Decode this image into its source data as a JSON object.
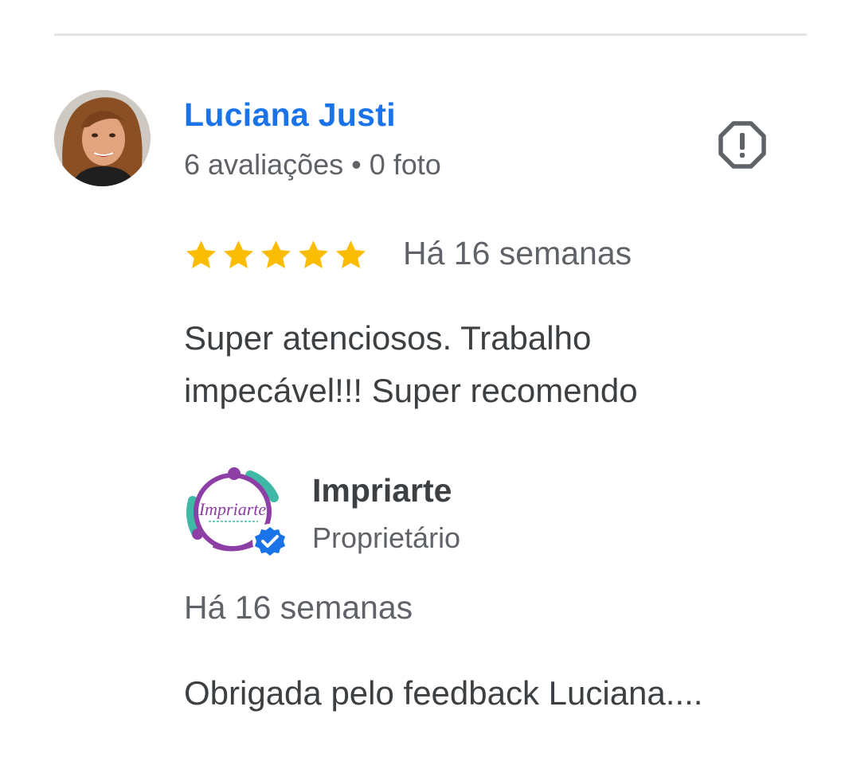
{
  "review": {
    "reviewer": {
      "name": "Luciana Justi",
      "meta": "6 avaliações • 0 foto",
      "avatar_icon": "reviewer-photo"
    },
    "report_icon": "report-flag-icon",
    "rating": 5,
    "rating_max": 5,
    "time": "Há 16 semanas",
    "text": "Super atenciosos. Trabalho impecável!!! Super recomendo"
  },
  "owner_reply": {
    "name": "Impriarte",
    "role": "Proprietário",
    "logo_text": "Impriarte",
    "verified_icon": "verified-badge-icon",
    "time": "Há 16 semanas",
    "text": "Obrigada pelo feedback Luciana...."
  },
  "colors": {
    "link": "#1a73e8",
    "star": "#fbbc04",
    "text_primary": "#3c4043",
    "text_secondary": "#5f6368",
    "divider": "#e3e3e3",
    "brand_purple": "#8e3fa6",
    "brand_teal": "#3fb8a6",
    "verified": "#1a73e8"
  }
}
